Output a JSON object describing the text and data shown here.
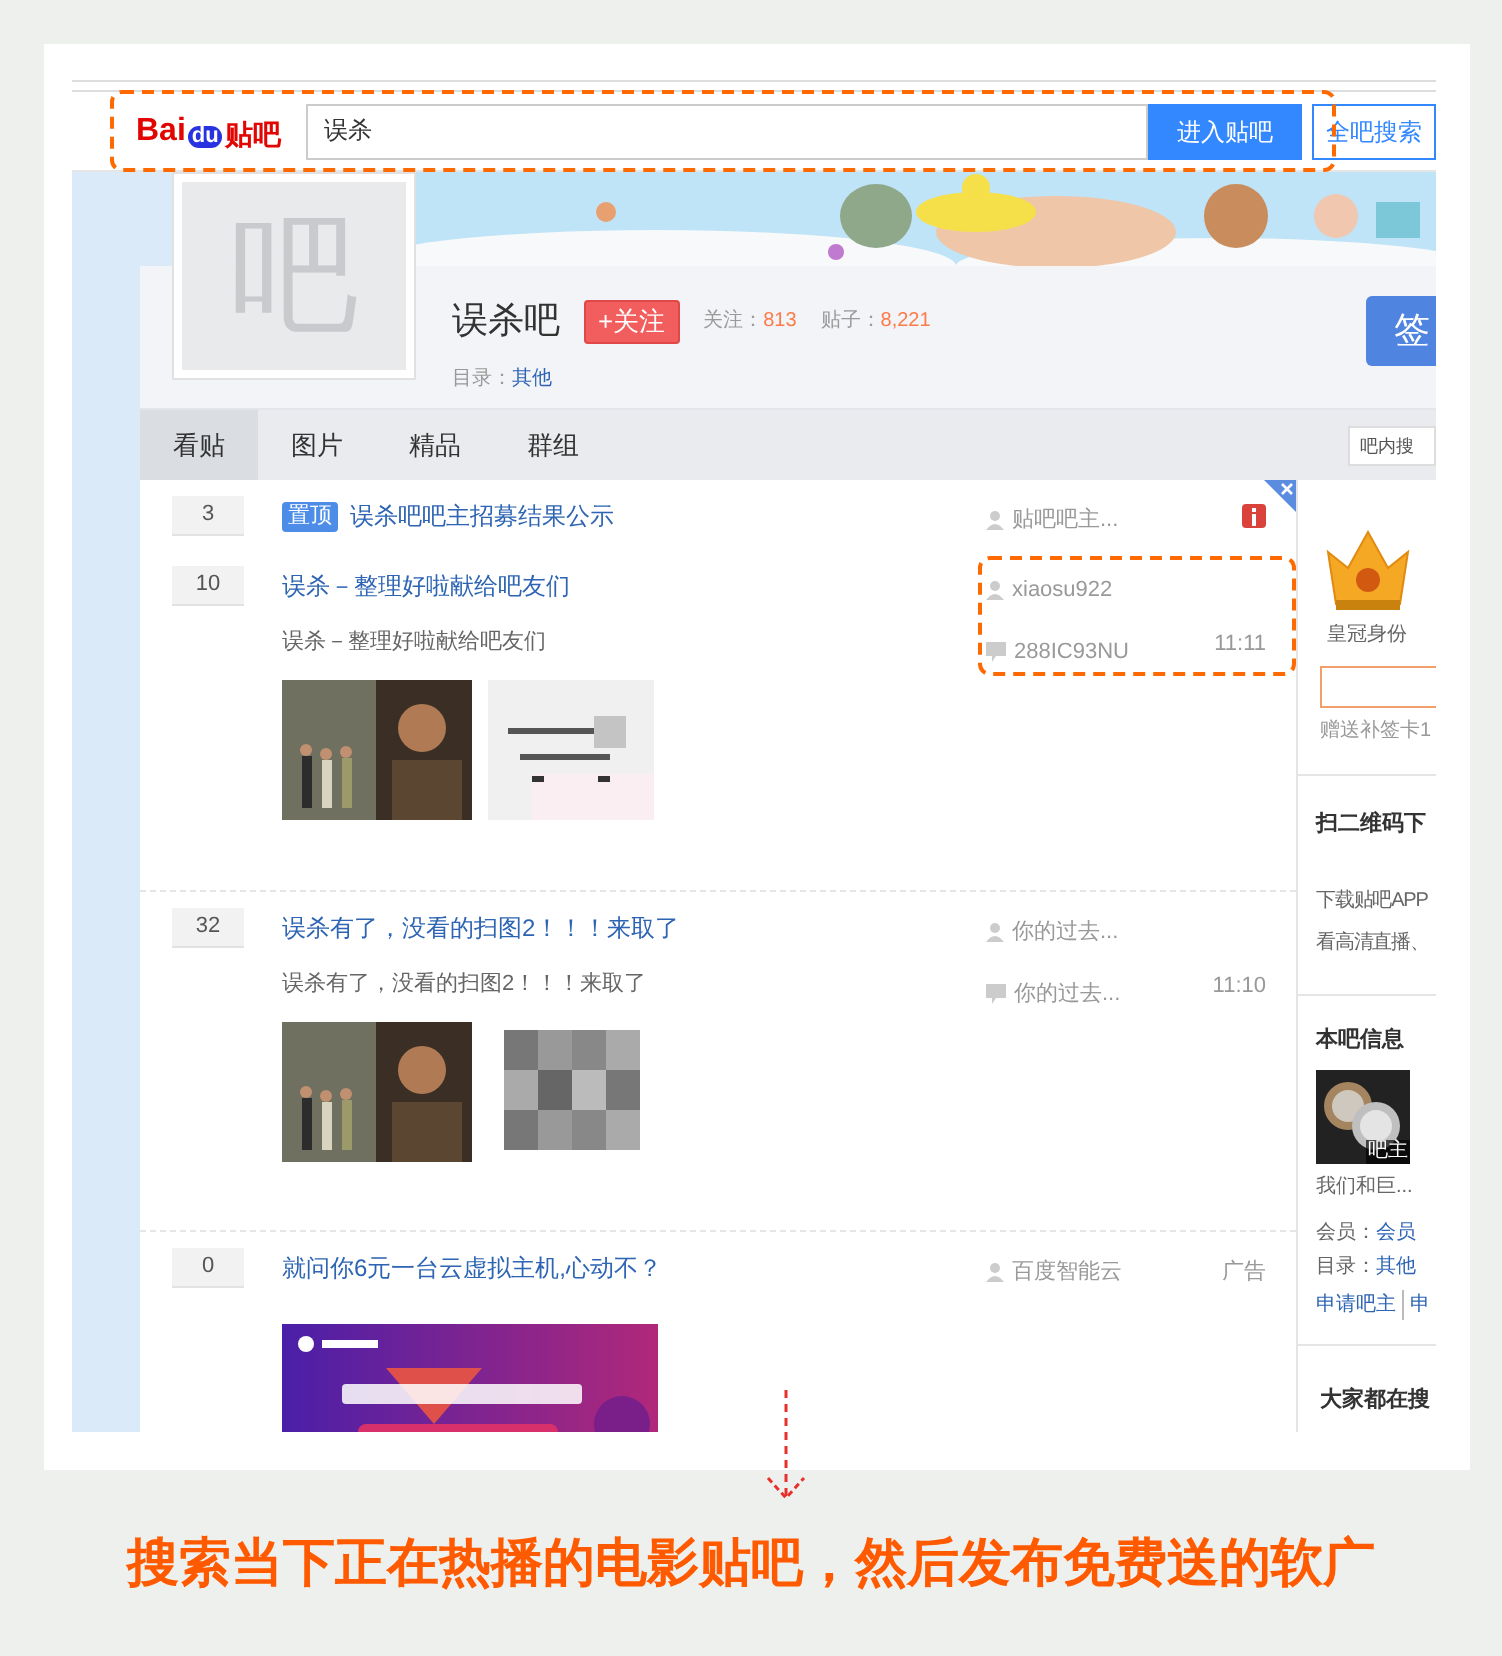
{
  "header": {
    "logo": {
      "part1": "Bai",
      "part2": "du",
      "part3": "贴吧"
    },
    "search": {
      "value": "误杀"
    },
    "buttons": [
      "进入贴吧",
      "全吧搜索"
    ]
  },
  "forum": {
    "avatar_char": "吧",
    "name": "误杀吧",
    "follow": "+关注",
    "stats": [
      {
        "label": "关注：",
        "value": "813"
      },
      {
        "label": "贴子：",
        "value": "8,221"
      }
    ],
    "category_label": "目录：",
    "category": "其他",
    "sign": "签"
  },
  "tabs": [
    {
      "label": "看贴",
      "selected": true
    },
    {
      "label": "图片",
      "selected": false
    },
    {
      "label": "精品",
      "selected": false
    },
    {
      "label": "群组",
      "selected": false
    }
  ],
  "inner_search": {
    "placeholder": "吧内搜"
  },
  "threads": [
    {
      "kind": "pinned",
      "replies": "3",
      "badge": "置顶",
      "title": "误杀吧吧主招募结果公示",
      "author": "贴吧吧主..."
    },
    {
      "kind": "post",
      "replies": "10",
      "title": "误杀－整理好啦献给吧友们",
      "excerpt": "误杀－整理好啦献给吧友们",
      "author": "xiaosu922",
      "last_reply": "288IC93NU",
      "time": "11:11",
      "images": [
        {
          "kind": "poster"
        },
        {
          "kind": "notice"
        }
      ]
    },
    {
      "kind": "post",
      "replies": "32",
      "title": "误杀有了，没看的扫图2！！！来取了",
      "excerpt": "误杀有了，没看的扫图2！！！来取了",
      "author": "你的过去...",
      "last_reply": "你的过去...",
      "time": "11:10",
      "images": [
        {
          "kind": "poster"
        },
        {
          "kind": "blurred"
        }
      ]
    },
    {
      "kind": "ad",
      "replies": "0",
      "title": "就问你6元一台云虚拟主机,心动不？",
      "author": "百度智能云",
      "tag": "广告",
      "images": [
        {
          "kind": "banner"
        }
      ]
    }
  ],
  "sidebar": {
    "crown_label": "皇冠身份",
    "gift": "赠送补签卡1",
    "qr_title": "扫二维码下",
    "qr_lines": [
      "下载贴吧APP",
      "看高清直播、"
    ],
    "info_title": "本吧信息",
    "info_badge": "吧主",
    "info_desc": "我们和巨...",
    "info_rows": [
      {
        "label": "会员：",
        "value": "会员"
      },
      {
        "label": "目录：",
        "value": "其他"
      }
    ],
    "info_links": [
      "申请吧主",
      "申"
    ],
    "search_title": "大家都在搜"
  },
  "caption": "搜索当下正在热播的电影贴吧，然后发布免费送的软广"
}
